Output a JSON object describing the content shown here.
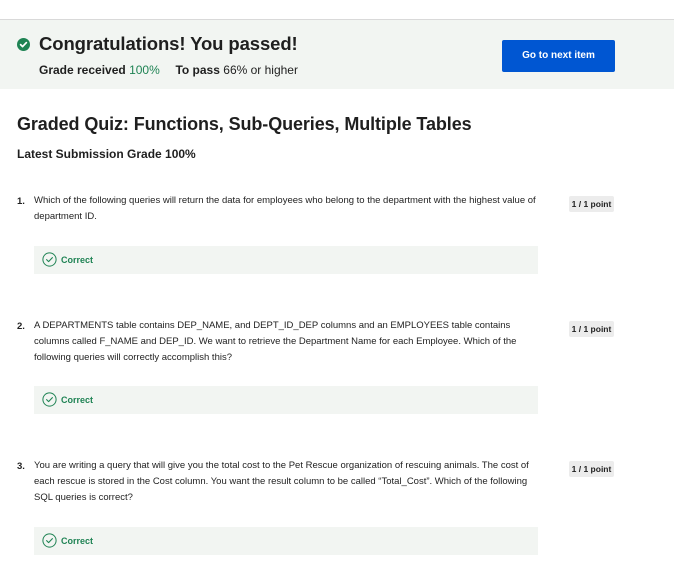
{
  "banner": {
    "title": "Congratulations! You passed!",
    "grade_label": "Grade received",
    "grade_value": "100%",
    "pass_label": "To pass",
    "pass_value": "66% or higher",
    "next_button": "Go to next item",
    "accent_color": "#1f8354",
    "button_color": "#0056d2"
  },
  "quiz": {
    "title": "Graded Quiz: Functions, Sub-Queries, Multiple Tables",
    "latest_grade": "Latest Submission Grade 100%"
  },
  "questions": [
    {
      "number": "1.",
      "text": "Which of the following queries will return the data for employees who belong to the department with the highest value of department ID.",
      "points": "1 / 1 point",
      "result": "Correct",
      "result_icon": "check-circle-icon"
    },
    {
      "number": "2.",
      "text": "A DEPARTMENTS table contains DEP_NAME, and DEPT_ID_DEP columns and an EMPLOYEES table contains columns called F_NAME and DEP_ID. We want to retrieve the Department Name for each Employee. Which of the following queries will correctly accomplish this?",
      "points": "1 / 1 point",
      "result": "Correct",
      "result_icon": "check-circle-icon"
    },
    {
      "number": "3.",
      "text": "You are writing a query that will give you the total cost to the Pet Rescue organization of rescuing animals. The cost of each rescue is stored in the Cost column. You want the result column to be called “Total_Cost”. Which of the following SQL queries is correct?",
      "points": "1 / 1 point",
      "result": "Correct",
      "result_icon": "check-circle-icon"
    }
  ]
}
